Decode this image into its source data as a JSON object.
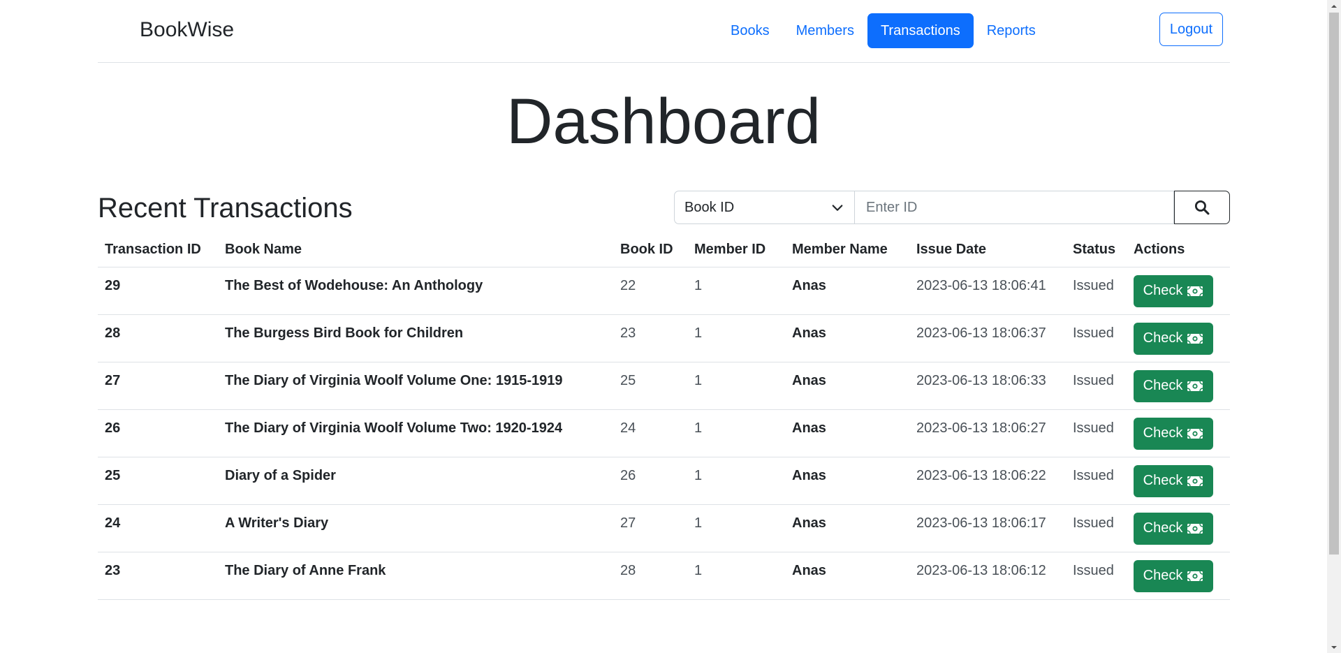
{
  "navbar": {
    "brand": "BookWise",
    "links": [
      {
        "label": "Books",
        "active": false
      },
      {
        "label": "Members",
        "active": false
      },
      {
        "label": "Transactions",
        "active": true
      },
      {
        "label": "Reports",
        "active": false
      }
    ],
    "logout_label": "Logout"
  },
  "page_title": "Dashboard",
  "section_title": "Recent Transactions",
  "search": {
    "select_value": "Book ID",
    "placeholder": "Enter ID",
    "icon": "search-icon"
  },
  "table": {
    "headers": [
      "Transaction ID",
      "Book Name",
      "Book ID",
      "Member ID",
      "Member Name",
      "Issue Date",
      "Status",
      "Actions"
    ],
    "rows": [
      {
        "transaction_id": "29",
        "book_name": "The Best of Wodehouse: An Anthology",
        "book_id": "22",
        "member_id": "1",
        "member_name": "Anas",
        "issue_date": "2023-06-13 18:06:41",
        "status": "Issued",
        "action": "Check"
      },
      {
        "transaction_id": "28",
        "book_name": "The Burgess Bird Book for Children",
        "book_id": "23",
        "member_id": "1",
        "member_name": "Anas",
        "issue_date": "2023-06-13 18:06:37",
        "status": "Issued",
        "action": "Check"
      },
      {
        "transaction_id": "27",
        "book_name": "The Diary of Virginia Woolf Volume One: 1915-1919",
        "book_id": "25",
        "member_id": "1",
        "member_name": "Anas",
        "issue_date": "2023-06-13 18:06:33",
        "status": "Issued",
        "action": "Check"
      },
      {
        "transaction_id": "26",
        "book_name": "The Diary of Virginia Woolf Volume Two: 1920-1924",
        "book_id": "24",
        "member_id": "1",
        "member_name": "Anas",
        "issue_date": "2023-06-13 18:06:27",
        "status": "Issued",
        "action": "Check"
      },
      {
        "transaction_id": "25",
        "book_name": "Diary of a Spider",
        "book_id": "26",
        "member_id": "1",
        "member_name": "Anas",
        "issue_date": "2023-06-13 18:06:22",
        "status": "Issued",
        "action": "Check"
      },
      {
        "transaction_id": "24",
        "book_name": "A Writer's Diary",
        "book_id": "27",
        "member_id": "1",
        "member_name": "Anas",
        "issue_date": "2023-06-13 18:06:17",
        "status": "Issued",
        "action": "Check"
      },
      {
        "transaction_id": "23",
        "book_name": "The Diary of Anne Frank",
        "book_id": "28",
        "member_id": "1",
        "member_name": "Anas",
        "issue_date": "2023-06-13 18:06:12",
        "status": "Issued",
        "action": "Check"
      }
    ],
    "action_icon": "cash-icon"
  },
  "colors": {
    "primary": "#0d6efd",
    "success": "#198754",
    "text": "#212529",
    "border": "#dee2e6"
  }
}
